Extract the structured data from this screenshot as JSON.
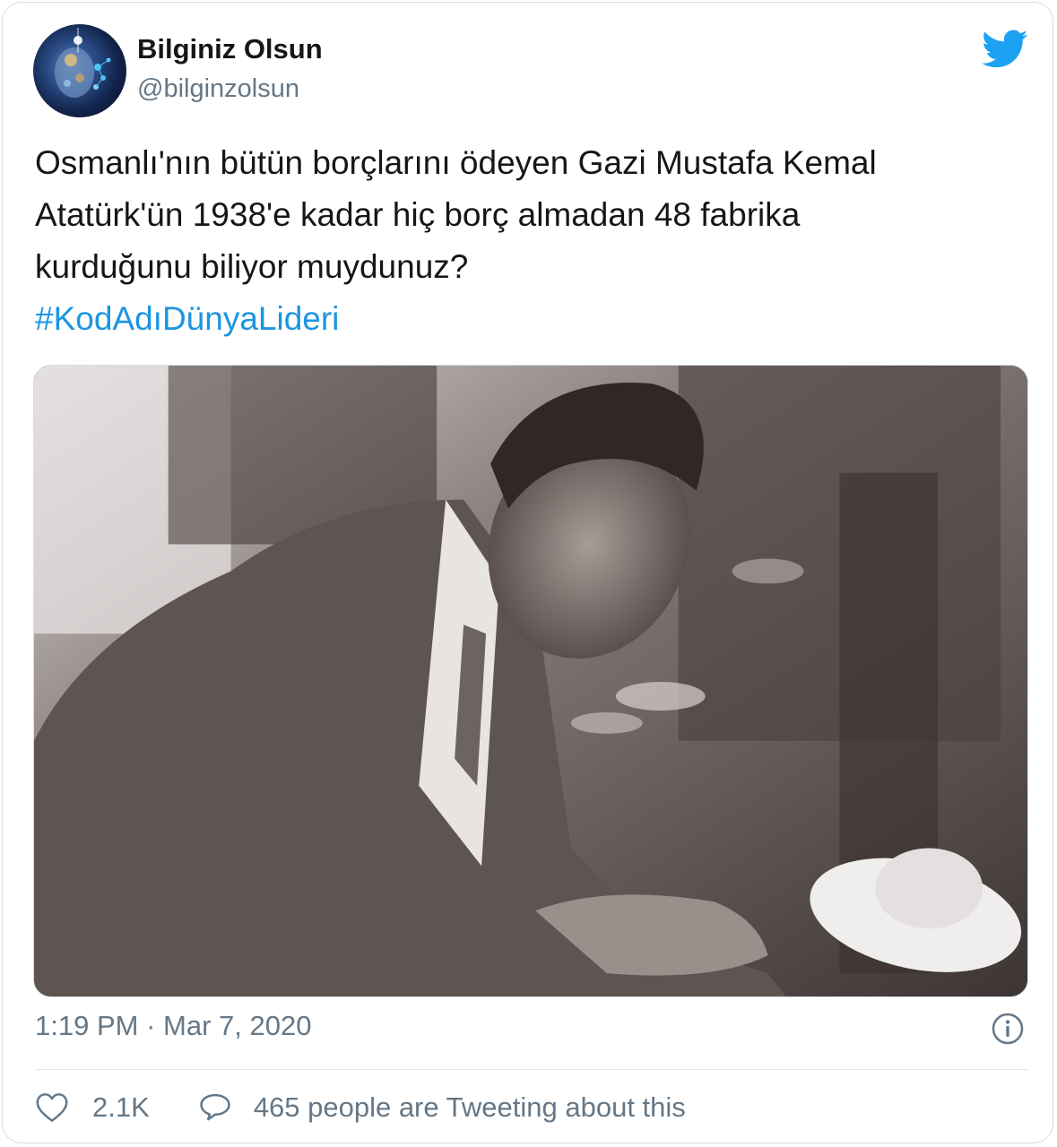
{
  "tweet": {
    "author_name": "Bilginiz Olsun",
    "author_handle": "@bilginzolsun",
    "avatar_icon": "avatar-image",
    "brand_icon": "twitter-bird-icon",
    "brand_color": "#1da1f2",
    "text_lines": [
      "Osmanlı'nın bütün borçlarını ödeyen Gazi Mustafa Kemal",
      "Atatürk'ün 1938'e kadar hiç borç almadan 48 fabrika",
      "kurduğunu biliyor muydunuz?"
    ],
    "hashtag": "#KodAdıDünyaLideri",
    "hashtag_color": "#1b95e0",
    "time": "1:19 PM",
    "separator": "·",
    "date": "Mar 7, 2020",
    "info_icon": "info-icon"
  },
  "engagement": {
    "like_icon": "heart-icon",
    "like_count": "2.1K",
    "reply_icon": "speech-bubble-icon",
    "tweeting_text": "465 people are Tweeting about this"
  },
  "colors": {
    "text_primary": "#14171a",
    "text_secondary": "#657786",
    "border": "#d7dde2"
  }
}
